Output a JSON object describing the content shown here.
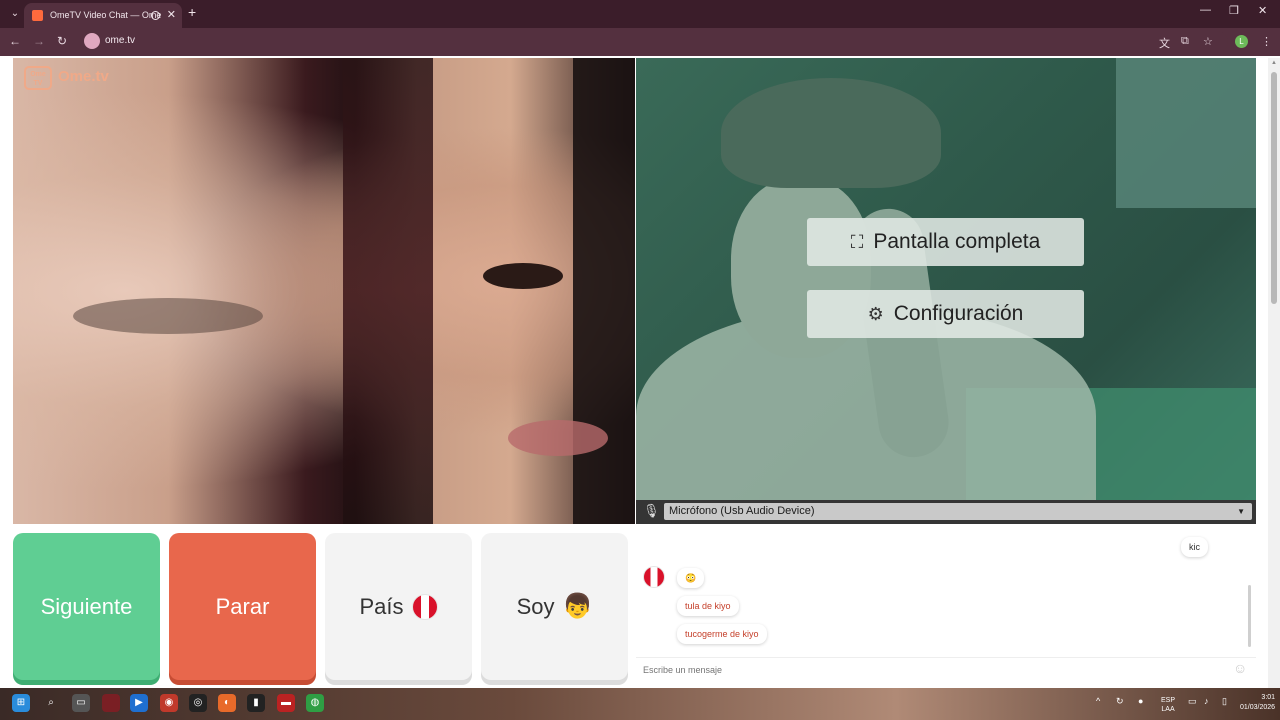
{
  "browser": {
    "tab_title": "OmeTV Video Chat — Ome",
    "url": "ome.tv",
    "profile_initial": "L"
  },
  "app": {
    "logo_badge": "Ome TV",
    "logo_text": "Ome.tv"
  },
  "overlay": {
    "fullscreen_label": "Pantalla completa",
    "settings_label": "Configuración"
  },
  "mic": {
    "selected": "Micrófono (Usb Audio Device)"
  },
  "controls": {
    "next_label": "Siguiente",
    "stop_label": "Parar",
    "country_label": "País",
    "gender_label": "Soy",
    "gender_emoji": "👦"
  },
  "chat": {
    "messages": [
      {
        "from": "me",
        "text": "kic"
      },
      {
        "from": "stranger",
        "text": "😳"
      },
      {
        "from": "stranger",
        "text": "tula de kiyo"
      },
      {
        "from": "stranger",
        "text": "tucogerme de kiyo"
      }
    ],
    "input_placeholder": "Escribe un mensaje"
  },
  "taskbar": {
    "lang_top": "ESP",
    "lang_bottom": "LAA",
    "time": "3:01",
    "date": "01/03/2026"
  },
  "colors": {
    "next": "#5fce93",
    "stop": "#e8674c",
    "accent": "#f0a988"
  }
}
